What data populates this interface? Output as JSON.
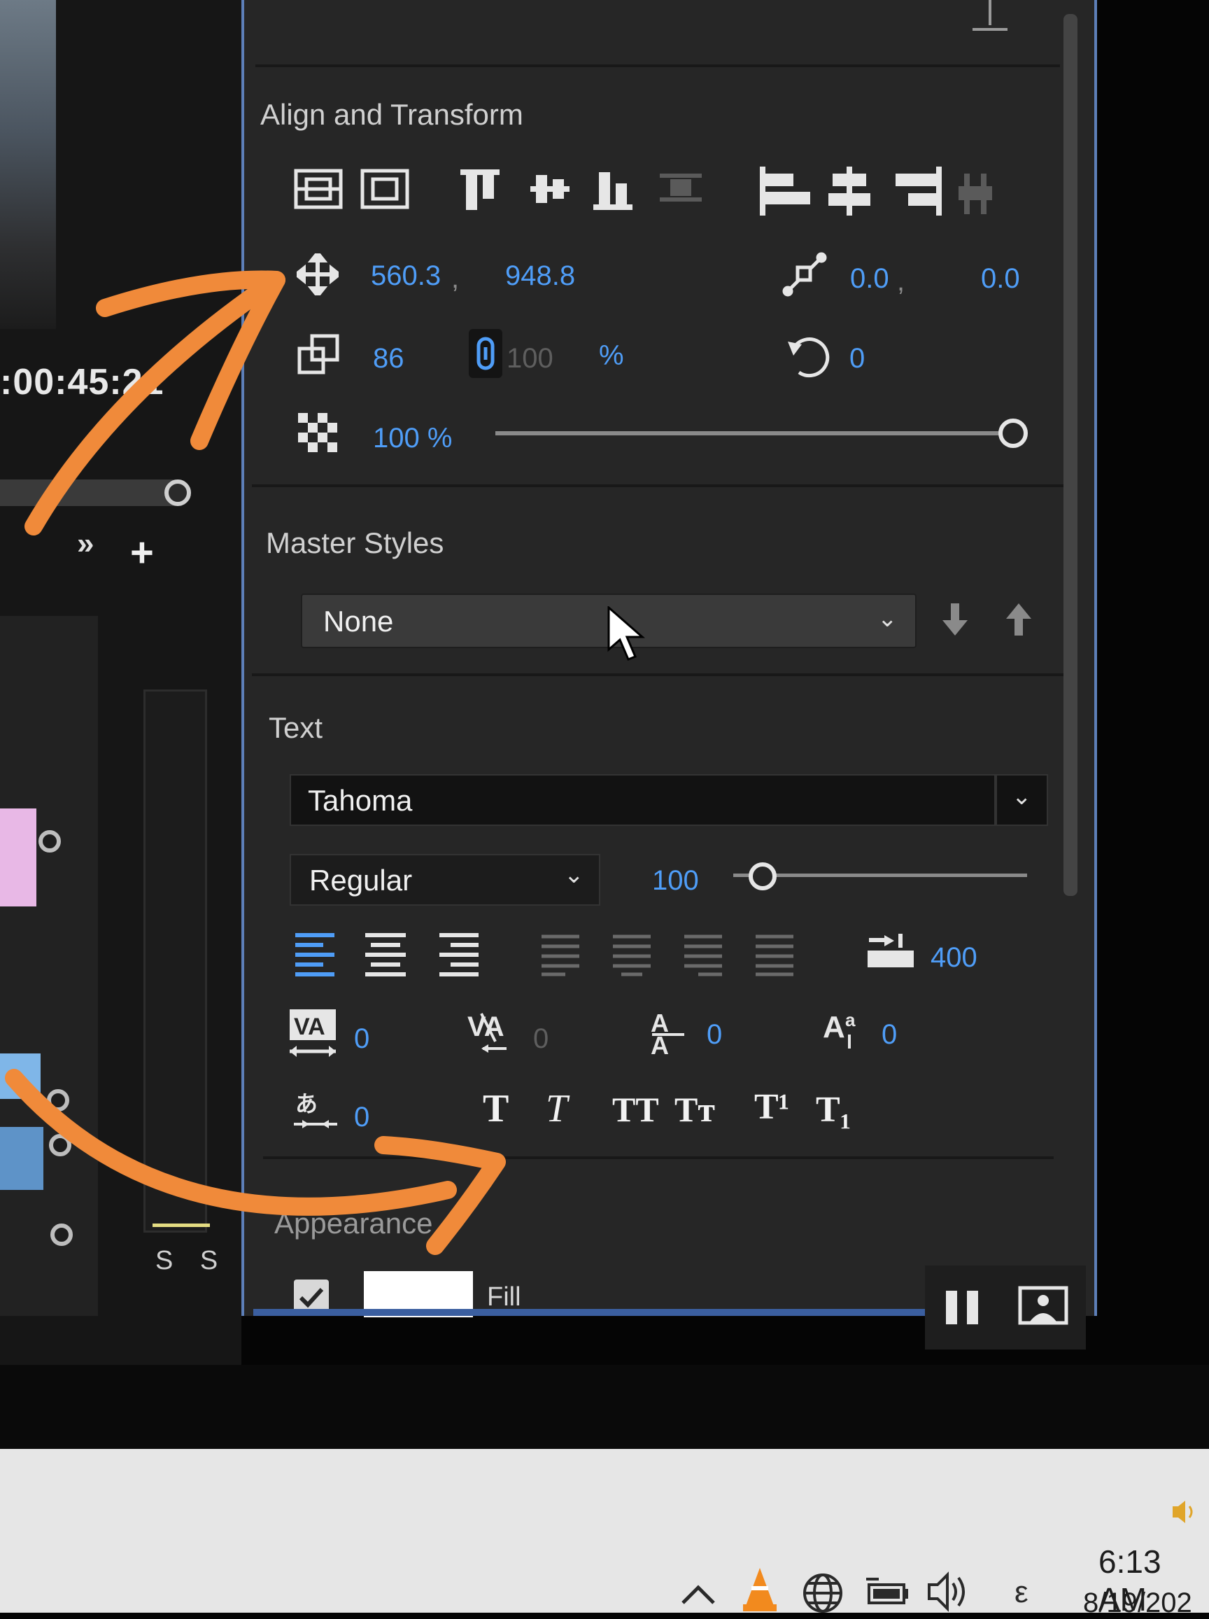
{
  "program_monitor": {
    "timecode": ":00:45:21",
    "meter_label": "S S"
  },
  "align_transform": {
    "title": "Align and Transform",
    "position_x": "560.3",
    "position_sep": ",",
    "position_y": "948.8",
    "anchor_x": "0.0",
    "anchor_sep": ",",
    "anchor_y": "0.0",
    "scale": "86",
    "scale_linked": "100",
    "scale_unit": "%",
    "rotation": "0",
    "opacity": "100 %",
    "opacity_value": 1.0
  },
  "master_styles": {
    "title": "Master Styles",
    "selected": "None"
  },
  "text": {
    "title": "Text",
    "font": "Tahoma",
    "style": "Regular",
    "size": "100",
    "size_slider": 0.1,
    "tab_width": "400",
    "kerning": "0",
    "tracking": "0",
    "leading": "0",
    "baseline_shift": "0",
    "tsume": "0",
    "faux_bold": "T",
    "faux_italic": "T",
    "all_caps": "TT",
    "small_caps": "Tт",
    "superscript": "T¹",
    "subscript": "T₁"
  },
  "appearance": {
    "title": "Appearance",
    "fill_label": "Fill",
    "fill_color": "#ffffff"
  },
  "taskbar": {
    "time": "6:13 AM",
    "date": "8/19/202",
    "lang": "ε"
  },
  "colors": {
    "accent_blue": "#4f9df7",
    "annotation_orange": "#f08a3a",
    "panel_bg": "#262626"
  }
}
